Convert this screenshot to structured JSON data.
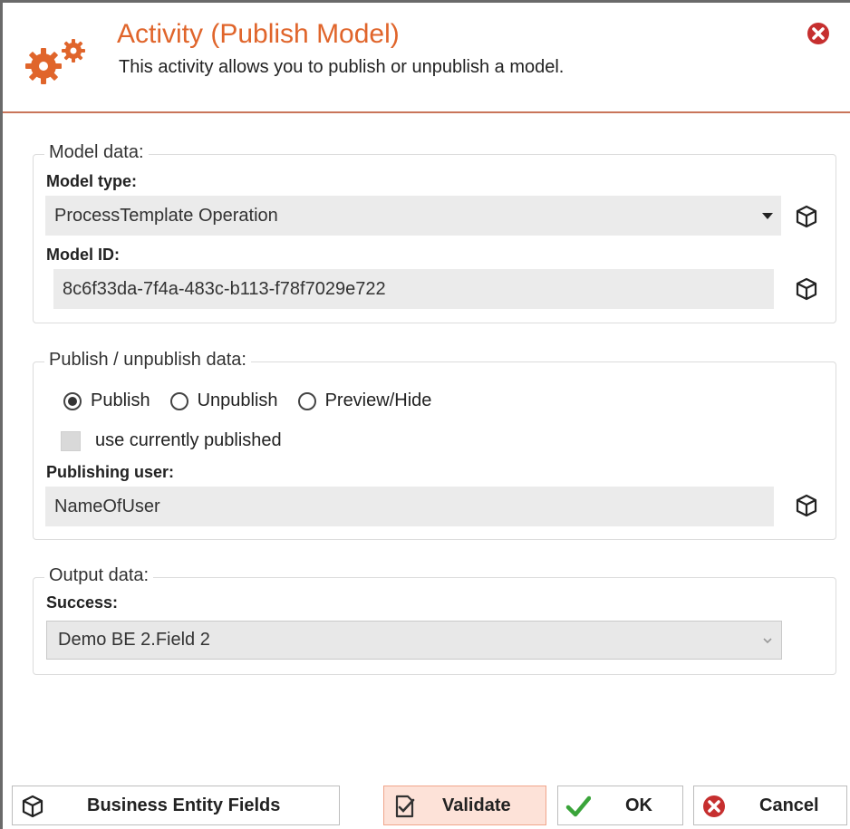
{
  "header": {
    "title": "Activity (Publish Model)",
    "subtitle": "This activity allows you to publish or unpublish a model.",
    "icon": "gears-icon",
    "accent_color": "#e0652b"
  },
  "model_group": {
    "legend": "Model data:",
    "model_type_label": "Model type:",
    "model_type_value": "ProcessTemplate Operation",
    "model_id_label": "Model ID:",
    "model_id_value": "8c6f33da-7f4a-483c-b113-f78f7029e722"
  },
  "publish_group": {
    "legend": "Publish / unpublish data:",
    "options": [
      "Publish",
      "Unpublish",
      "Preview/Hide"
    ],
    "selected": "Publish",
    "use_current_label": "use currently published",
    "use_current_checked": false,
    "user_label": "Publishing user:",
    "user_value": "NameOfUser"
  },
  "output_group": {
    "legend": "Output data:",
    "success_label": "Success:",
    "success_value": "Demo BE 2.Field 2"
  },
  "footer": {
    "business_entity_label": "Business Entity Fields",
    "validate_label": "Validate",
    "ok_label": "OK",
    "cancel_label": "Cancel"
  }
}
